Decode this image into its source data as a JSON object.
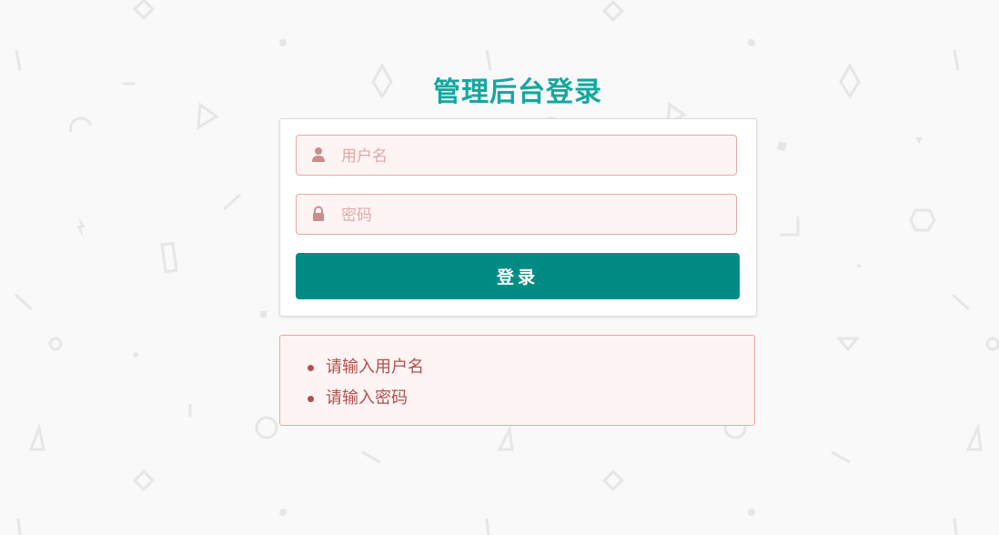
{
  "page": {
    "title": "管理后台登录"
  },
  "login_form": {
    "username": {
      "value": "",
      "placeholder": "用户名",
      "icon": "user-icon"
    },
    "password": {
      "value": "",
      "placeholder": "密码",
      "icon": "lock-icon"
    },
    "submit_label": "登录"
  },
  "errors": {
    "items": [
      "请输入用户名",
      "请输入密码"
    ]
  },
  "colors": {
    "accent": "#14a7a0",
    "button": "#008c84",
    "error_text": "#b0504d",
    "error_border": "#e8a8a6",
    "error_bg": "#fdf4f3"
  }
}
